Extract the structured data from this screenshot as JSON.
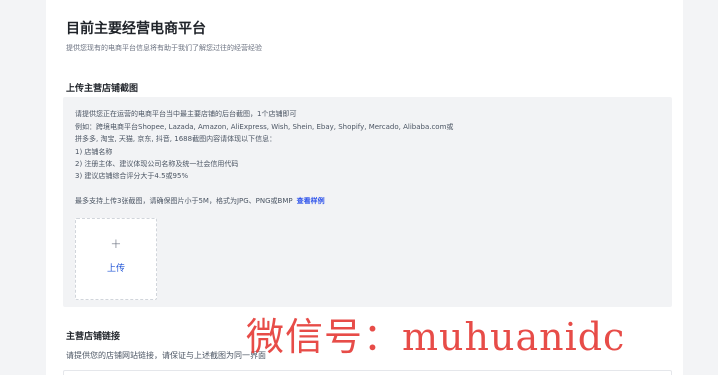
{
  "page": {
    "title": "目前主要经营电商平台",
    "subtitle": "提供您现有的电商平台信息将有助于我们了解您过往的经营经验"
  },
  "upload_section": {
    "title": "上传主营店铺截图",
    "requirements": [
      "请提供您正在运营的电商平台当中最主要店铺的后台截图，1个店铺即可",
      "例如：跨境电商平台Shopee, Lazada, Amazon, AliExpress, Wish, Shein, Ebay, Shopify, Mercado, Alibaba.com或",
      "拼多多, 淘宝, 天猫, 京东, 抖音, 1688截图内容请体现以下信息：",
      "1) 店铺名称",
      "2) 注册主体、建议体现公司名称及统一社会信用代码",
      "3) 建议店铺综合评分大于4.5或95%"
    ],
    "limit_text": "最多支持上传3张截图，请确保图片小于5M，格式为JPG、PNG或BMP",
    "sample_link": "查看样例",
    "upload_plus": "+",
    "upload_label": "上传"
  },
  "link_section": {
    "title": "主营店铺链接",
    "description": "请提供您的店铺网站链接，请保证与上述截图为同一界面"
  },
  "watermark": "微信号：muhuanidc"
}
